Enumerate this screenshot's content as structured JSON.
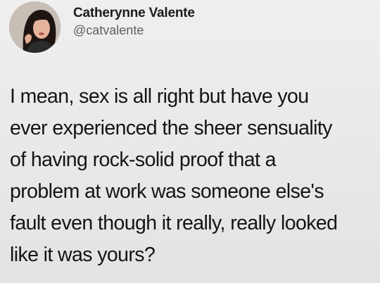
{
  "author": {
    "display_name": "Catherynne Valente",
    "handle": "@catvalente"
  },
  "tweet": {
    "lines": [
      "I mean, sex is all right but have you",
      "ever experienced the sheer sensuality",
      "of having rock-solid proof that a",
      "problem at work was someone else's",
      "fault even though it really, really looked",
      "like it was yours?"
    ]
  },
  "colors": {
    "background": "#e9e9e9",
    "text": "#151515",
    "handle": "#5f5f5f"
  }
}
